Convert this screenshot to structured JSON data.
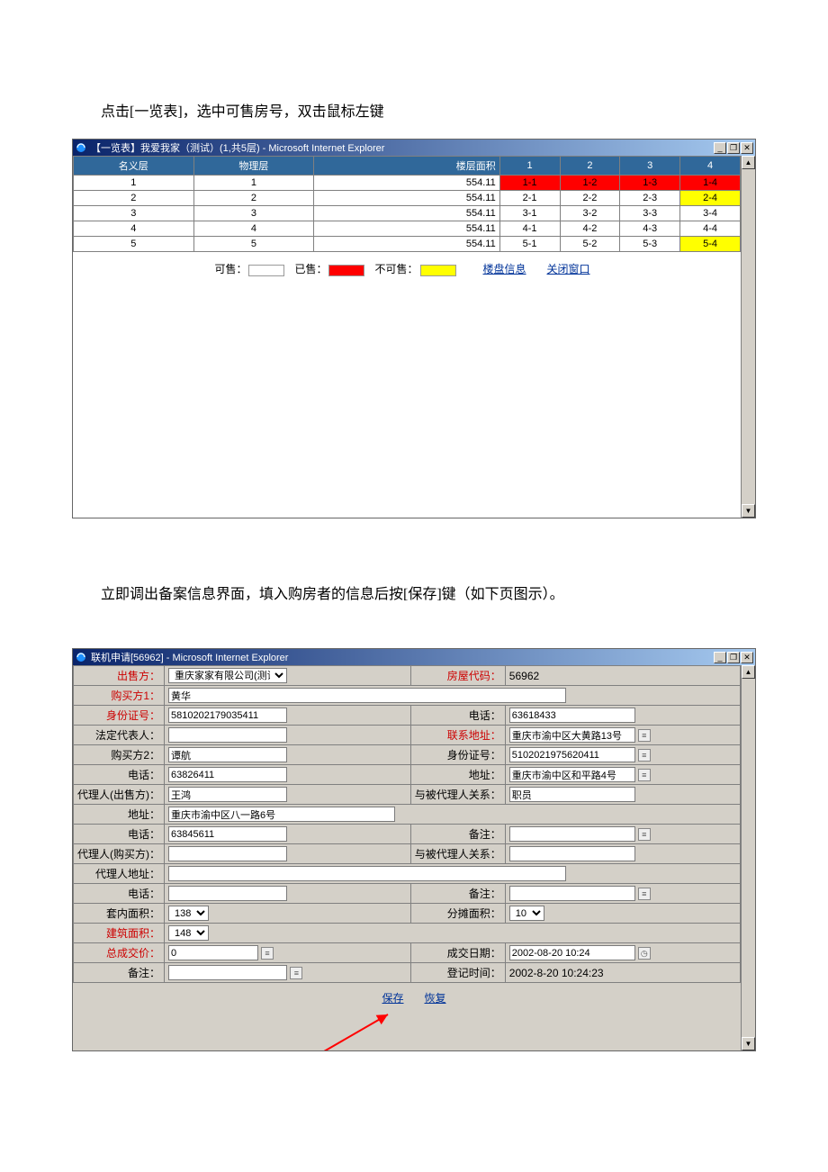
{
  "caption1": "点击[一览表]，选中可售房号，双击鼠标左键",
  "caption2": "立即调出备案信息界面，填入购房者的信息后按[保存]键（如下页图示）。",
  "window1": {
    "title": "【一览表】我爱我家（测试）(1,共5层) - Microsoft Internet Explorer",
    "headers": [
      "名义层",
      "物理层",
      "楼层面积",
      "1",
      "2",
      "3",
      "4"
    ],
    "rows": [
      {
        "name": "1",
        "phys": "1",
        "area": "554.11",
        "cells": [
          {
            "t": "1-1",
            "c": "red"
          },
          {
            "t": "1-2",
            "c": "red"
          },
          {
            "t": "1-3",
            "c": "red"
          },
          {
            "t": "1-4",
            "c": "red"
          }
        ]
      },
      {
        "name": "2",
        "phys": "2",
        "area": "554.11",
        "cells": [
          {
            "t": "2-1"
          },
          {
            "t": "2-2"
          },
          {
            "t": "2-3"
          },
          {
            "t": "2-4",
            "c": "yellow"
          }
        ]
      },
      {
        "name": "3",
        "phys": "3",
        "area": "554.11",
        "cells": [
          {
            "t": "3-1"
          },
          {
            "t": "3-2"
          },
          {
            "t": "3-3"
          },
          {
            "t": "3-4"
          }
        ]
      },
      {
        "name": "4",
        "phys": "4",
        "area": "554.11",
        "cells": [
          {
            "t": "4-1"
          },
          {
            "t": "4-2"
          },
          {
            "t": "4-3"
          },
          {
            "t": "4-4"
          }
        ]
      },
      {
        "name": "5",
        "phys": "5",
        "area": "554.11",
        "cells": [
          {
            "t": "5-1"
          },
          {
            "t": "5-2"
          },
          {
            "t": "5-3"
          },
          {
            "t": "5-4",
            "c": "yellow"
          }
        ]
      }
    ],
    "legend": {
      "available": "可售：",
      "sold": "已售：",
      "unavailable": "不可售：",
      "link_info": "楼盘信息",
      "link_close": "关闭窗口"
    }
  },
  "window2": {
    "title": "联机申请[56962] - Microsoft Internet Explorer",
    "labels": {
      "seller": "出售方：",
      "house_code": "房屋代码：",
      "buyer1": "购买方1：",
      "id_no": "身份证号：",
      "phone": "电话：",
      "legal_rep": "法定代表人：",
      "contact_addr": "联系地址：",
      "buyer2": "购买方2：",
      "id_no2": "身份证号：",
      "phone2": "电话：",
      "address2": "地址：",
      "agent_seller": "代理人(出售方)：",
      "agent_rel": "与被代理人关系：",
      "address": "地址：",
      "phone3": "电话：",
      "remark": "备注：",
      "agent_buyer": "代理人(购买方)：",
      "agent_rel2": "与被代理人关系：",
      "agent_addr": "代理人地址：",
      "phone4": "电话：",
      "remark2": "备注：",
      "inner_area": "套内面积：",
      "share_area": "分摊面积：",
      "build_area": "建筑面积：",
      "total_price": "总成交价：",
      "deal_date": "成交日期：",
      "reg_time": "登记时间：",
      "remark3": "备注："
    },
    "values": {
      "seller": "重庆家家有限公司(测试)",
      "house_code": "56962",
      "buyer1": "黄华",
      "id_no": "5810202179035411",
      "phone": "63618433",
      "legal_rep": "",
      "contact_addr": "重庆市渝中区大黄路13号",
      "buyer2": "谭航",
      "id_no2": "5102021975620411",
      "phone2": "63826411",
      "address2": "重庆市渝中区和平路4号",
      "agent_seller": "王鸿",
      "agent_rel": "职员",
      "address": "重庆市渝中区八一路6号",
      "phone3": "63845611",
      "remark": "",
      "agent_buyer": "",
      "agent_rel2": "",
      "agent_addr": "",
      "phone4": "",
      "remark2": "",
      "inner_area": "138",
      "share_area": "10",
      "build_area": "148",
      "total_price": "0",
      "deal_date": "2002-08-20 10:24",
      "reg_time": "2002-8-20 10:24:23",
      "remark3": ""
    },
    "actions": {
      "save": "保存",
      "restore": "恢复"
    }
  }
}
